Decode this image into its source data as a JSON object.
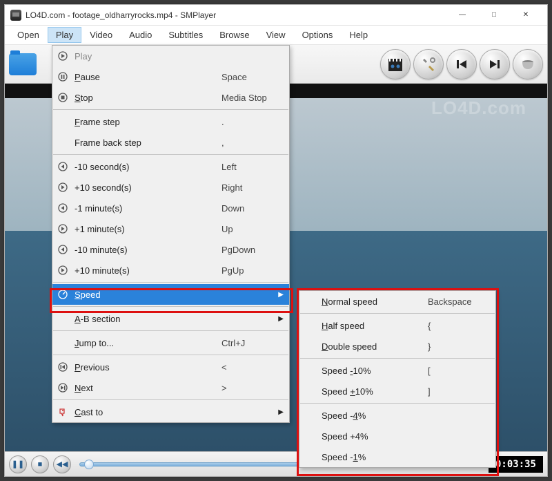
{
  "title": "LO4D.com - footage_oldharryrocks.mp4 - SMPlayer",
  "window_controls": {
    "min": "—",
    "max": "□",
    "close": "✕"
  },
  "menubar": [
    "Open",
    "Play",
    "Video",
    "Audio",
    "Subtitles",
    "Browse",
    "View",
    "Options",
    "Help"
  ],
  "active_menu_index": 1,
  "toolbar": {
    "folder_icon": "folder-open-icon",
    "buttons": [
      "clapper-icon",
      "tools-icon",
      "skip-prev-icon",
      "skip-next-icon",
      "volume-icon"
    ]
  },
  "video": {
    "watermark": "LO4D.com",
    "time_display": "0:03:35"
  },
  "play_menu": [
    {
      "icon": "play-icon",
      "label": "Play",
      "shortcut": "",
      "disabled": true
    },
    {
      "icon": "pause-icon",
      "label": "Pause",
      "underline": 0,
      "shortcut": "Space"
    },
    {
      "icon": "stop-icon",
      "label": "Stop",
      "underline": 0,
      "shortcut": "Media Stop"
    },
    {
      "sep": true
    },
    {
      "icon": "",
      "label": "Frame step",
      "underline": 0,
      "shortcut": "."
    },
    {
      "icon": "",
      "label": "Frame back step",
      "shortcut": ","
    },
    {
      "sep": true
    },
    {
      "icon": "rewind-icon",
      "label": "-10 second(s)",
      "shortcut": "Left"
    },
    {
      "icon": "forward-icon",
      "label": "+10 second(s)",
      "shortcut": "Right"
    },
    {
      "icon": "rewind-icon",
      "label": "-1 minute(s)",
      "shortcut": "Down"
    },
    {
      "icon": "forward-icon",
      "label": "+1 minute(s)",
      "shortcut": "Up"
    },
    {
      "icon": "rewind-icon",
      "label": "-10 minute(s)",
      "shortcut": "PgDown"
    },
    {
      "icon": "forward-icon",
      "label": "+10 minute(s)",
      "shortcut": "PgUp"
    },
    {
      "sep": true
    },
    {
      "icon": "speed-icon",
      "label": "Speed",
      "underline": 0,
      "submenu": true,
      "highlighted": true
    },
    {
      "sep": true
    },
    {
      "icon": "",
      "label": "A-B section",
      "underline": 0,
      "submenu": true
    },
    {
      "sep": true
    },
    {
      "icon": "",
      "label": "Jump to...",
      "underline": 0,
      "shortcut": "Ctrl+J"
    },
    {
      "sep": true
    },
    {
      "icon": "prev-icon",
      "label": "Previous",
      "underline": 0,
      "shortcut": "<"
    },
    {
      "icon": "next-icon",
      "label": "Next",
      "underline": 0,
      "shortcut": ">"
    },
    {
      "sep": true
    },
    {
      "icon": "cast-icon",
      "label": "Cast to",
      "underline": 0,
      "submenu": true
    }
  ],
  "speed_menu": [
    {
      "label": "Normal speed",
      "underline": 0,
      "shortcut": "Backspace"
    },
    {
      "sep": true
    },
    {
      "label": "Half speed",
      "underline": 0,
      "shortcut": "{"
    },
    {
      "label": "Double speed",
      "underline": 0,
      "shortcut": "}"
    },
    {
      "sep": true
    },
    {
      "label": "Speed -10%",
      "underline": 6,
      "shortcut": "["
    },
    {
      "label": "Speed +10%",
      "underline": 6,
      "shortcut": "]"
    },
    {
      "sep": true
    },
    {
      "label": "Speed -4%",
      "underline": 7,
      "shortcut": ""
    },
    {
      "label": "Speed +4%",
      "shortcut": ""
    },
    {
      "label": "Speed -1%",
      "underline": 7,
      "shortcut": ""
    }
  ],
  "playbar_buttons": [
    "pause-icon",
    "stop-icon",
    "rewind-icon"
  ]
}
